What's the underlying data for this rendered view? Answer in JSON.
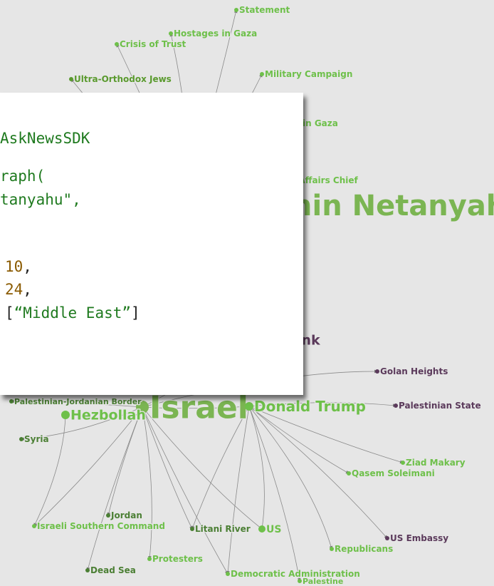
{
  "colors": {
    "background": "#e6e6e6",
    "green_node": "#5aa832",
    "dark_green_node": "#4b7f34",
    "purple_node": "#6b3f6b",
    "light_green_node": "#6ec04a",
    "edge": "#8a8a8a"
  },
  "graph": {
    "nodes": [
      {
        "id": "statement",
        "label": "Statement",
        "color": "#6ec04a",
        "size": "small"
      },
      {
        "id": "hostages",
        "label": "Hostages in Gaza",
        "color": "#6ec04a",
        "size": "small"
      },
      {
        "id": "crisis",
        "label": "Crisis of Trust",
        "color": "#6ec04a",
        "size": "small"
      },
      {
        "id": "military",
        "label": "Military Campaign",
        "color": "#6ec04a",
        "size": "small"
      },
      {
        "id": "ultra",
        "label": "Ultra-Orthodox Jews",
        "color": "#5a9a2e",
        "size": "small"
      },
      {
        "id": "wargaza",
        "label": "War in Gaza",
        "color": "#6ec04a",
        "size": "small"
      },
      {
        "id": "foreign",
        "label": "Foreign Affairs Chief",
        "color": "#6ec04a",
        "size": "small"
      },
      {
        "id": "netanyahu",
        "label": "Benjamin Netanyahu",
        "color": "#7bb552",
        "size": "huge"
      },
      {
        "id": "westbank",
        "label": "West Bank",
        "color": "#5b3a5b",
        "size": "medium"
      },
      {
        "id": "golan",
        "label": "Golan Heights",
        "color": "#5b3a5b",
        "size": "small"
      },
      {
        "id": "israel",
        "label": "Israel",
        "color": "#7bb552",
        "size": "huge"
      },
      {
        "id": "paljordan",
        "label": "Palestinian-Jordanian Border",
        "color": "#4b7f34",
        "size": "small"
      },
      {
        "id": "hezbollah",
        "label": "Hezbollah",
        "color": "#6ec04a",
        "size": "medium"
      },
      {
        "id": "trump",
        "label": "Donald Trump",
        "color": "#6ec04a",
        "size": "large"
      },
      {
        "id": "palstate",
        "label": "Palestinian State",
        "color": "#5b3a5b",
        "size": "small"
      },
      {
        "id": "syria",
        "label": "Syria",
        "color": "#4b7f34",
        "size": "small"
      },
      {
        "id": "ziad",
        "label": "Ziad Makary",
        "color": "#6ec04a",
        "size": "small"
      },
      {
        "id": "qasem",
        "label": "Qasem Soleimani",
        "color": "#6ec04a",
        "size": "small"
      },
      {
        "id": "jordan",
        "label": "Jordan",
        "color": "#4b7f34",
        "size": "small"
      },
      {
        "id": "southern",
        "label": "Israeli Southern Command",
        "color": "#6ec04a",
        "size": "small"
      },
      {
        "id": "litani",
        "label": "Litani River",
        "color": "#4b7f34",
        "size": "small"
      },
      {
        "id": "us",
        "label": "US",
        "color": "#6ec04a",
        "size": "medium"
      },
      {
        "id": "embassy",
        "label": "US Embassy",
        "color": "#5b3a5b",
        "size": "small"
      },
      {
        "id": "republicans",
        "label": "Republicans",
        "color": "#6ec04a",
        "size": "small"
      },
      {
        "id": "protesters",
        "label": "Protesters",
        "color": "#6ec04a",
        "size": "small"
      },
      {
        "id": "deadsea",
        "label": "Dead Sea",
        "color": "#4b7f34",
        "size": "small"
      },
      {
        "id": "democratic",
        "label": "Democratic Administration",
        "color": "#6ec04a",
        "size": "small"
      },
      {
        "id": "palestine",
        "label": "Palestine",
        "color": "#6ec04a",
        "size": "small"
      }
    ]
  },
  "code_panel": {
    "lines": [
      [
        {
          "t": "AskNewsSDK",
          "c": "c-green"
        }
      ],
      [
        {
          "t": "raph(",
          "c": "c-green"
        }
      ],
      [
        {
          "t": "tanyahu\",",
          "c": "c-green"
        }
      ],
      [
        {
          "t": "10",
          "c": "c-num"
        },
        {
          "t": ",",
          "c": "c-dark"
        }
      ],
      [
        {
          "t": "24",
          "c": "c-num"
        },
        {
          "t": ",",
          "c": "c-dark"
        }
      ],
      [
        {
          "t": "[",
          "c": "c-dark"
        },
        {
          "t": "“Middle East”",
          "c": "c-green"
        },
        {
          "t": "]",
          "c": "c-dark"
        }
      ]
    ]
  }
}
